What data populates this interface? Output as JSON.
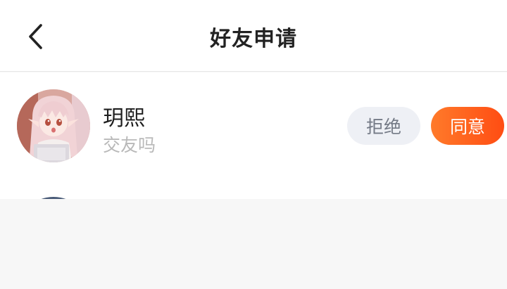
{
  "header": {
    "title": "好友申请",
    "back_icon": "chevron-left-icon"
  },
  "requests": [
    {
      "name": "玥熙",
      "message": "交友吗",
      "reject_label": "拒绝",
      "accept_label": "同意"
    }
  ],
  "colors": {
    "accent_start": "#ff7a2a",
    "accent_end": "#ff4d13",
    "reject_bg": "#eef0f5",
    "page_bg": "#f7f7f7"
  }
}
